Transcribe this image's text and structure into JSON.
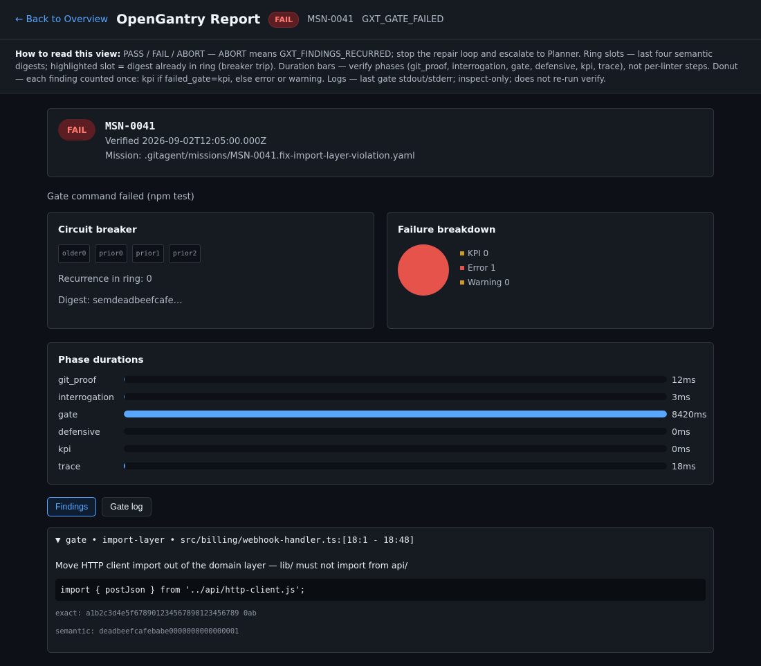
{
  "topbar": {
    "back_label": "← Back to Overview",
    "title": "OpenGantry Report",
    "status": "FAIL",
    "mission_id": "MSN-0041",
    "error_code": "GXT_GATE_FAILED"
  },
  "howto": {
    "lead": "How to read this view:",
    "text": "PASS / FAIL / ABORT — ABORT means GXT_FINDINGS_RECURRED; stop the repair loop and escalate to Planner. Ring slots — last four semantic digests; highlighted slot = digest already in ring (breaker trip). Duration bars — verify phases (git_proof, interrogation, gate, defensive, kpi, trace), not per-linter steps. Donut — each finding counted once: kpi if failed_gate=kpi, else error or warning. Logs — last gate stdout/stderr; inspect-only; does not re-run verify."
  },
  "summary": {
    "status": "FAIL",
    "mission_id": "MSN-0041",
    "verified": "Verified 2026-09-02T12:05:00.000Z",
    "mission_path": "Mission: .gitagent/missions/MSN-0041.fix-import-layer-violation.yaml"
  },
  "gate_message": "Gate command failed (npm test)",
  "circuit_breaker": {
    "title": "Circuit breaker",
    "slots": [
      "older0",
      "prior0",
      "prior1",
      "prior2"
    ],
    "recurrence": "Recurrence in ring: 0",
    "digest": "Digest: semdeadbeefcafe…"
  },
  "failure_breakdown": {
    "title": "Failure breakdown",
    "legend": [
      {
        "label": "KPI 0",
        "value": 0,
        "color": "#d29922"
      },
      {
        "label": "Error 1",
        "value": 1,
        "color": "#e5534b"
      },
      {
        "label": "Warning 0",
        "value": 0,
        "color": "#d29922"
      }
    ]
  },
  "phases": {
    "title": "Phase durations",
    "max_ms": 8420,
    "items": [
      {
        "name": "git_proof",
        "ms": 12,
        "label": "12ms"
      },
      {
        "name": "interrogation",
        "ms": 3,
        "label": "3ms"
      },
      {
        "name": "gate",
        "ms": 8420,
        "label": "8420ms"
      },
      {
        "name": "defensive",
        "ms": 0,
        "label": "0ms"
      },
      {
        "name": "kpi",
        "ms": 0,
        "label": "0ms"
      },
      {
        "name": "trace",
        "ms": 18,
        "label": "18ms"
      }
    ]
  },
  "tabs": {
    "findings": "Findings",
    "gate_log": "Gate log"
  },
  "finding": {
    "header": "▼ gate • import-layer • src/billing/webhook-handler.ts:[18:1 - 18:48]",
    "message": "Move HTTP client import out of the domain layer — lib/ must not import from api/",
    "code": "import { postJson } from '../api/http-client.js';",
    "exact": "exact: a1b2c3d4e5f678901234567890123456789 0ab",
    "semantic": "semantic: deadbeefcafebabe0000000000000001"
  },
  "colors": {
    "accent": "#58a6ff",
    "fail": "#ff7b72",
    "error": "#e5534b"
  }
}
